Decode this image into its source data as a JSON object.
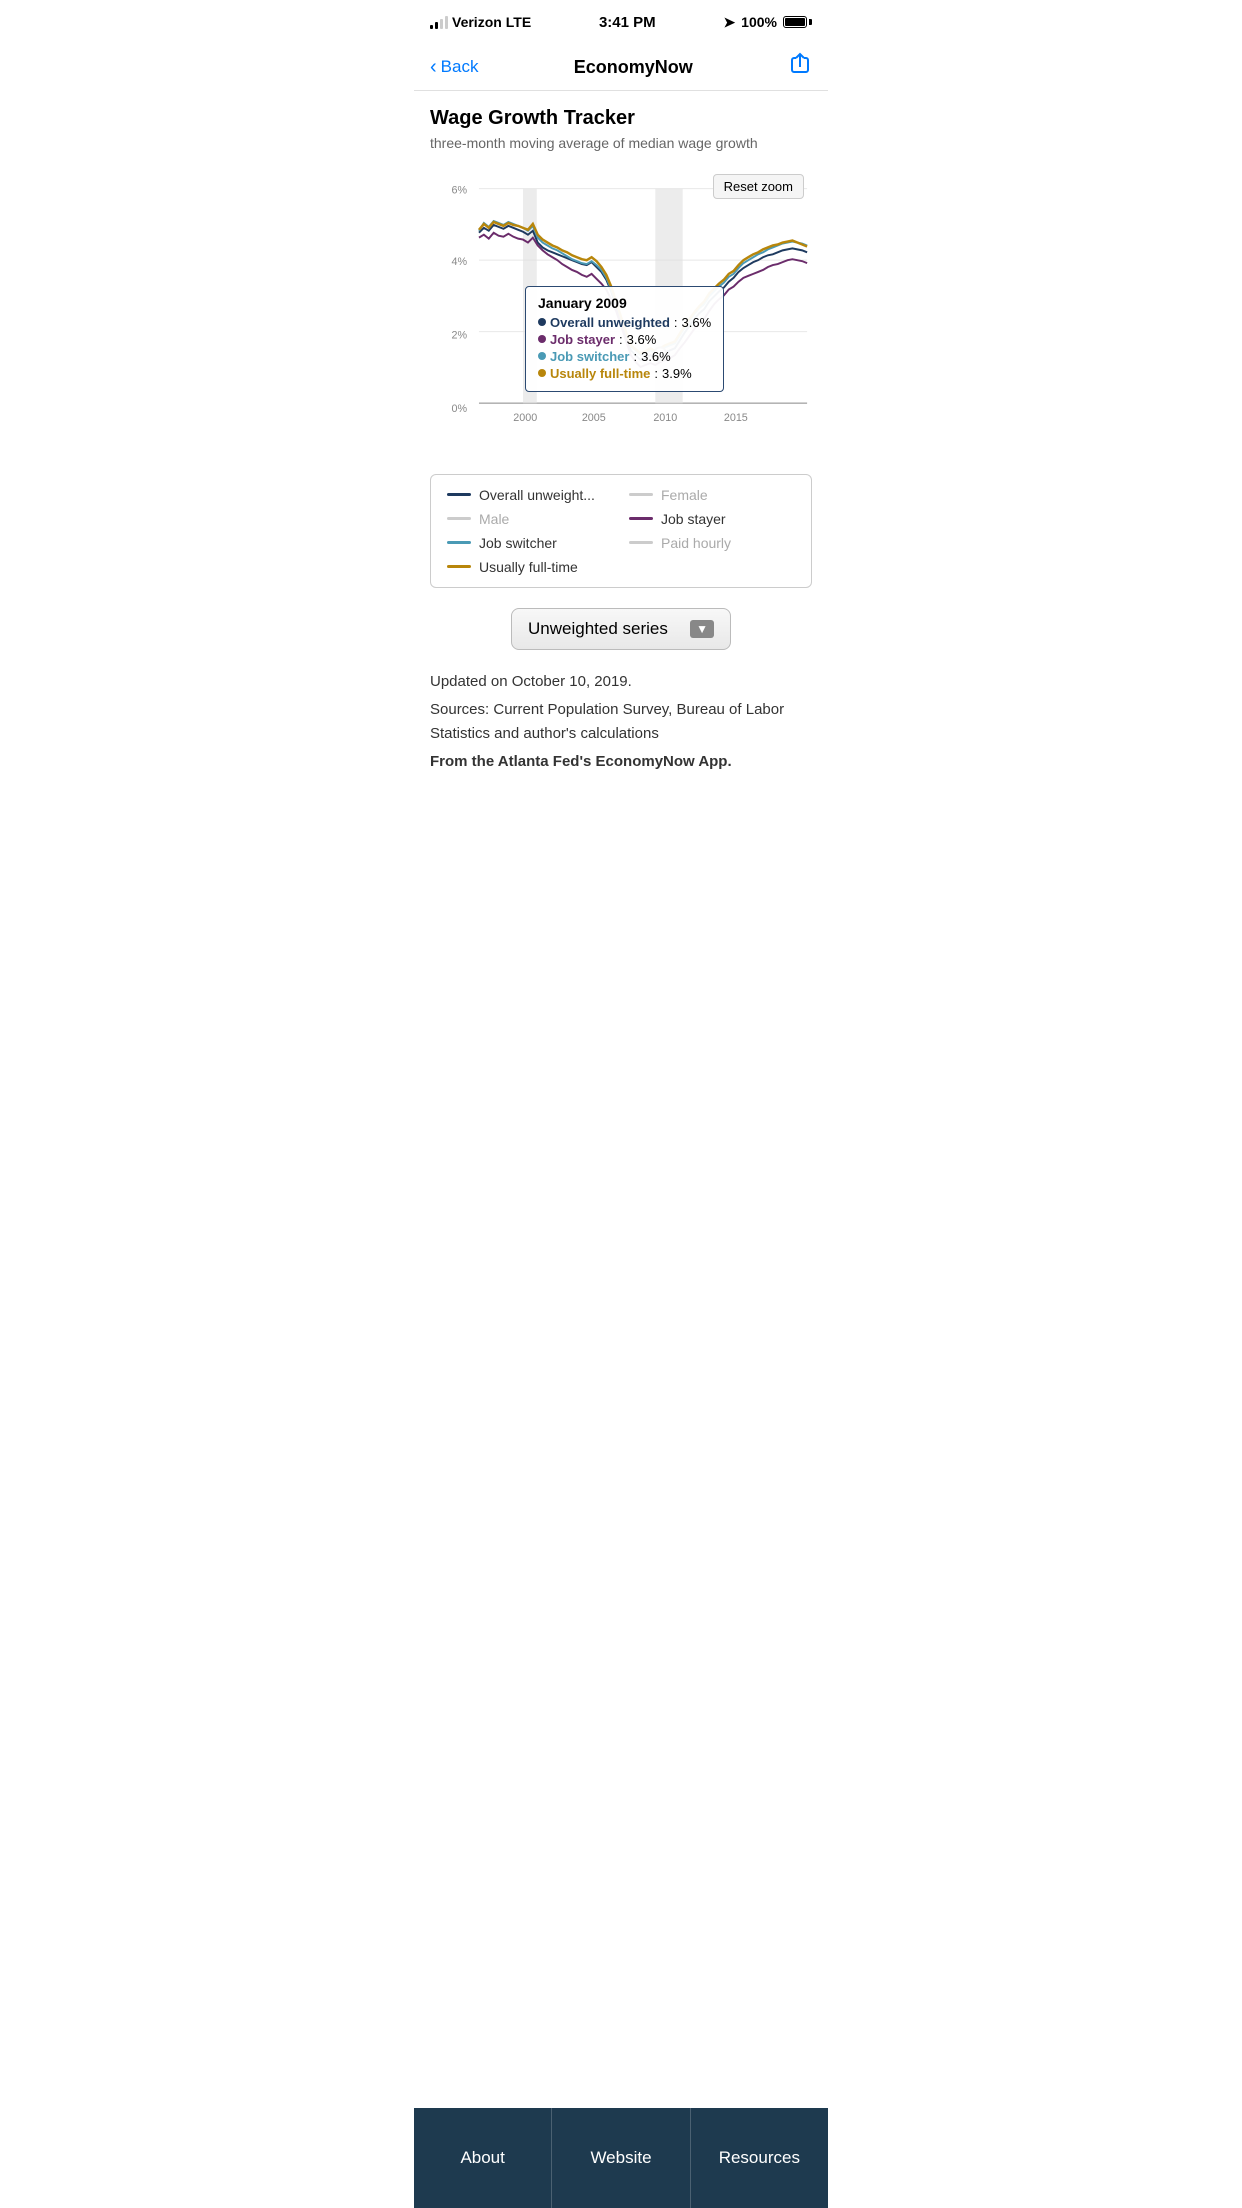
{
  "status": {
    "carrier": "Verizon",
    "network": "LTE",
    "time": "3:41 PM",
    "battery": "100%",
    "location": true
  },
  "nav": {
    "back_label": "Back",
    "title": "EconomyNow",
    "share_icon": "share"
  },
  "chart": {
    "title": "Wage Growth Tracker",
    "subtitle": "three-month moving average of median wage growth",
    "reset_zoom": "Reset zoom",
    "tooltip": {
      "date": "January 2009",
      "overall_label": "Overall unweighted",
      "overall_value": "3.6%",
      "job_stayer_label": "Job stayer",
      "job_stayer_value": "3.6%",
      "job_switcher_label": "Job switcher",
      "job_switcher_value": "3.6%",
      "usually_fulltime_label": "Usually full-time",
      "usually_fulltime_value": "3.9%"
    },
    "y_axis": [
      "6%",
      "4%",
      "2%",
      "0%"
    ],
    "x_axis": [
      "2000",
      "2005",
      "2010",
      "2015"
    ]
  },
  "legend": {
    "items": [
      {
        "label": "Overall unweight...",
        "color": "#1e3a5f",
        "active": true
      },
      {
        "label": "Female",
        "color": "#ccc",
        "active": false
      },
      {
        "label": "Male",
        "color": "#ccc",
        "active": false
      },
      {
        "label": "Job stayer",
        "color": "#6b2c6b",
        "active": true
      },
      {
        "label": "Job switcher",
        "color": "#4a9ab5",
        "active": true
      },
      {
        "label": "Paid hourly",
        "color": "#ccc",
        "active": false
      },
      {
        "label": "Usually full-time",
        "color": "#b8860b",
        "active": true
      }
    ]
  },
  "dropdown": {
    "label": "Unweighted series",
    "arrow": "▼"
  },
  "info": {
    "updated": "Updated on October 10, 2019.",
    "sources": "Sources: Current Population Survey, Bureau of Labor Statistics and author's calculations",
    "attribution": "From the Atlanta Fed's EconomyNow App."
  },
  "tabs": [
    {
      "label": "About"
    },
    {
      "label": "Website"
    },
    {
      "label": "Resources"
    }
  ]
}
